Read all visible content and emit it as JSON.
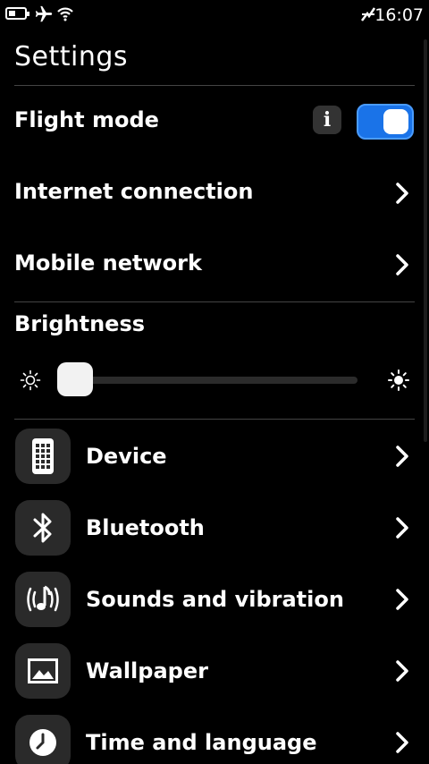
{
  "status_bar": {
    "time": "16:07",
    "icons": [
      "battery-icon",
      "airplane-icon",
      "wifi-icon",
      "network-off-icon"
    ]
  },
  "header": {
    "title": "Settings"
  },
  "flight_mode": {
    "label": "Flight mode",
    "enabled": true,
    "info_icon": "info-icon"
  },
  "connection_items": [
    {
      "label": "Internet connection"
    },
    {
      "label": "Mobile network"
    }
  ],
  "brightness": {
    "label": "Brightness",
    "level": 0.0
  },
  "menu_items": [
    {
      "label": "Device",
      "icon": "device-icon"
    },
    {
      "label": "Bluetooth",
      "icon": "bluetooth-icon"
    },
    {
      "label": "Sounds and vibration",
      "icon": "sound-icon"
    },
    {
      "label": "Wallpaper",
      "icon": "wallpaper-icon"
    },
    {
      "label": "Time and language",
      "icon": "clock-icon"
    }
  ],
  "colors": {
    "accent": "#1a73e8",
    "background": "#000000",
    "divider": "#444444"
  }
}
